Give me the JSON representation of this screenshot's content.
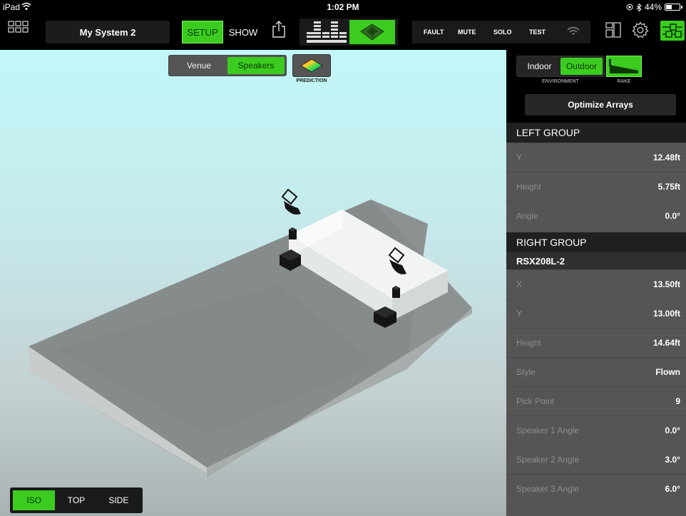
{
  "status": {
    "device": "iPad",
    "time": "1:02 PM",
    "battery": "44%",
    "battery_level": 0.44
  },
  "toolbar": {
    "system_name": "My System 2",
    "setup_label": "SETUP",
    "show_label": "SHOW",
    "fault_label": "FAULT",
    "mute_label": "MUTE",
    "solo_label": "SOLO",
    "test_label": "TEST"
  },
  "viewport": {
    "venue_tab": "Venue",
    "speakers_tab": "Speakers",
    "prediction_label": "PREDICTION",
    "view_tabs": [
      "ISO",
      "TOP",
      "SIDE"
    ],
    "selected_view": "ISO"
  },
  "panel": {
    "indoor_label": "Indoor",
    "outdoor_label": "Outdoor",
    "environment_label": "ENVIRONMENT",
    "rake_label": "RAKE",
    "optimize_label": "Optimize Arrays",
    "left_group": {
      "title": "LEFT GROUP",
      "rows": [
        {
          "label": "Y",
          "value": "12.48ft"
        },
        {
          "label": "Height",
          "value": "5.75ft"
        },
        {
          "label": "Angle",
          "value": "0.0°"
        }
      ]
    },
    "right_group": {
      "title": "RIGHT GROUP",
      "subtitle": "RSX208L-2",
      "rows": [
        {
          "label": "X",
          "value": "13.50ft"
        },
        {
          "label": "Y",
          "value": "13.00ft"
        },
        {
          "label": "Height",
          "value": "14.64ft"
        },
        {
          "label": "Style",
          "value": "Flown"
        },
        {
          "label": "Pick Point",
          "value": "9"
        },
        {
          "label": "Speaker 1 Angle",
          "value": "0.0°"
        },
        {
          "label": "Speaker 2 Angle",
          "value": "3.0°"
        },
        {
          "label": "Speaker 3 Angle",
          "value": "6.0°"
        }
      ]
    }
  },
  "colors": {
    "accent": "#3bcc1f",
    "panel": "#555555",
    "header": "#202020"
  }
}
